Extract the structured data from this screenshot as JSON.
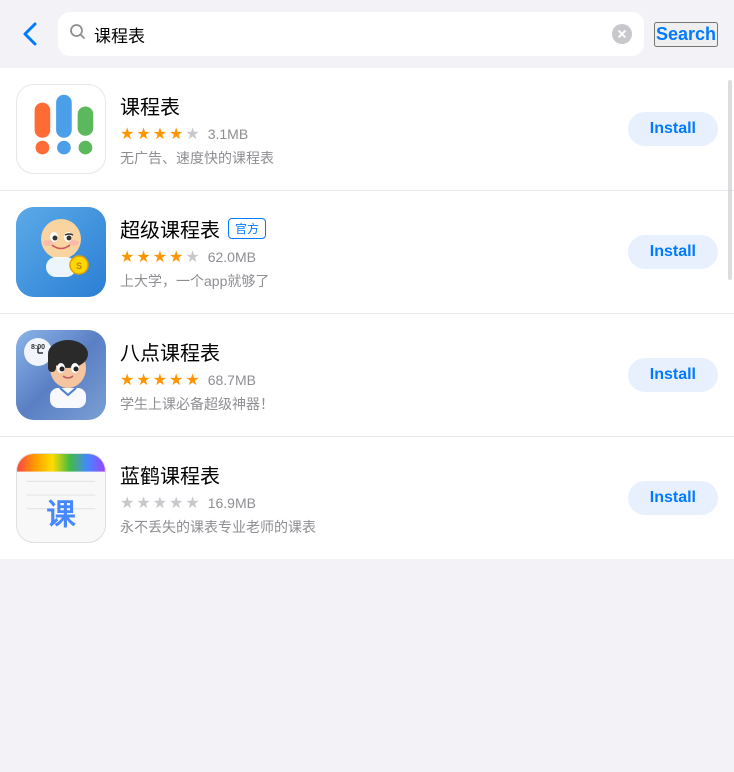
{
  "header": {
    "back_label": "‹",
    "search_value": "课程表",
    "search_placeholder": "课程表",
    "search_button_label": "Search"
  },
  "apps": [
    {
      "id": "kechengbiao",
      "name": "课程表",
      "rating": 3.5,
      "max_rating": 5,
      "size": "3.1MB",
      "description": "无广告、速度快的课程表",
      "install_label": "Install",
      "has_official_badge": false,
      "stars_filled": 3,
      "stars_half": 1,
      "stars_empty": 1
    },
    {
      "id": "super",
      "name": "超级课程表",
      "rating": 4.0,
      "max_rating": 5,
      "size": "62.0MB",
      "description": "上大学，一个app就够了",
      "install_label": "Install",
      "has_official_badge": true,
      "official_badge_text": "官方",
      "stars_filled": 4,
      "stars_half": 0,
      "stars_empty": 1
    },
    {
      "id": "badian",
      "name": "八点课程表",
      "rating": 5.0,
      "max_rating": 5,
      "size": "68.7MB",
      "description": "学生上课必备超级神器！",
      "install_label": "Install",
      "has_official_badge": false,
      "stars_filled": 5,
      "stars_half": 0,
      "stars_empty": 0
    },
    {
      "id": "lanhe",
      "name": "蓝鹤课程表",
      "rating": 0,
      "max_rating": 5,
      "size": "16.9MB",
      "description": "永不丢失的课表专业老师的课表",
      "install_label": "Install",
      "has_official_badge": false,
      "stars_filled": 0,
      "stars_half": 0,
      "stars_empty": 5
    }
  ],
  "colors": {
    "accent": "#007aff",
    "star": "#ff9500",
    "star_empty": "#c7c7cc",
    "install_bg": "#e8f0fe",
    "text_secondary": "#8e8e93"
  }
}
